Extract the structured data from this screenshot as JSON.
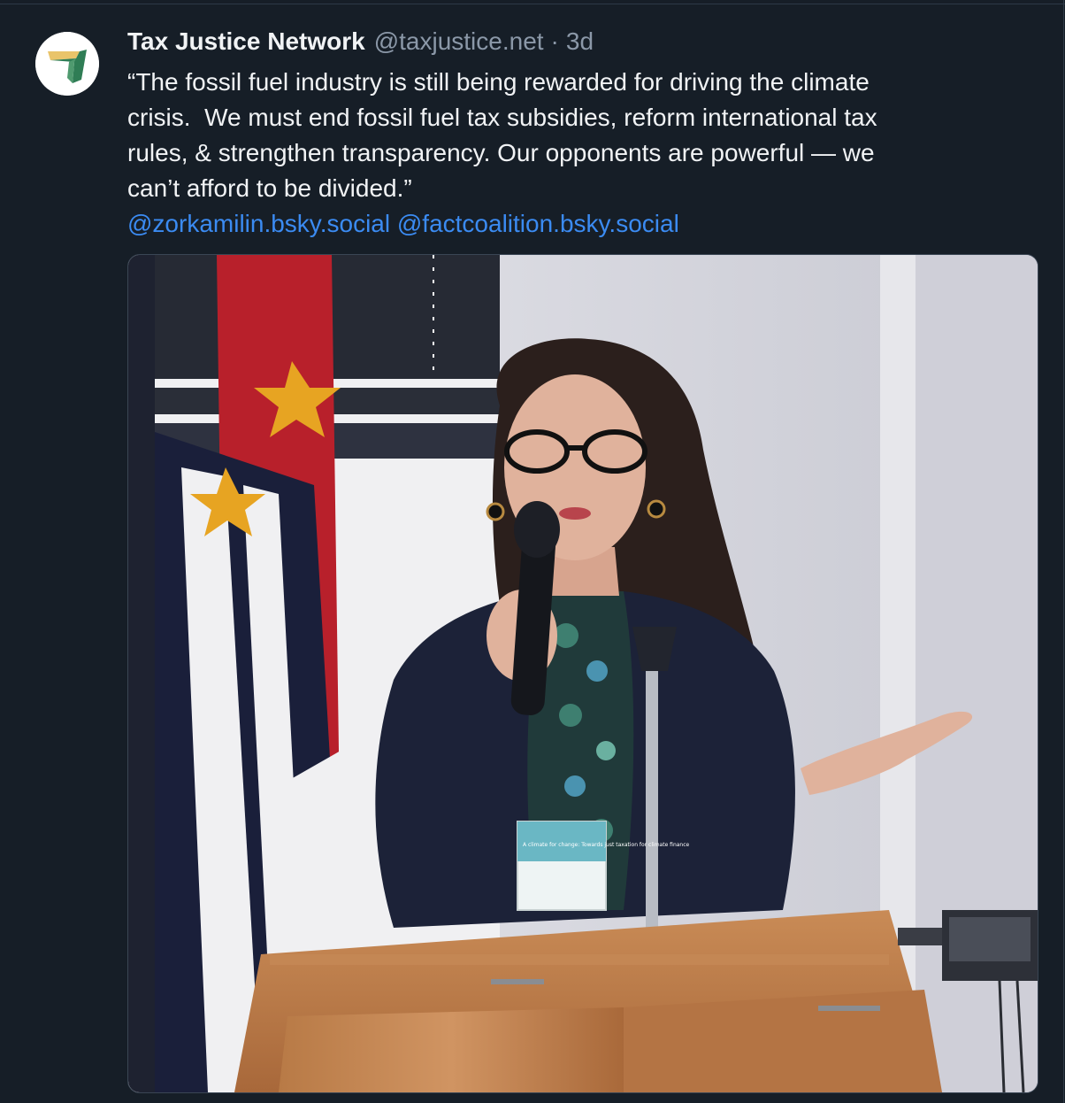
{
  "post": {
    "author": {
      "display_name": "Tax Justice Network",
      "handle": "@taxjustice.net",
      "separator": "·",
      "time_ago": "3d",
      "avatar_icon": "tax-justice-network-logo"
    },
    "text_lines": [
      "“The fossil fuel industry is still being rewarded for driving the climate",
      "crisis.  We must end fossil fuel tax subsidies, reform international tax",
      "rules, & strengthen transparency. Our opponents are powerful — we",
      "can’t afford to be divided.”"
    ],
    "mentions": [
      "@zorkamilin.bsky.social",
      "@factcoalition.bsky.social"
    ],
    "image": {
      "badge_text": "A climate for change: Towards just taxation for climate finance"
    }
  },
  "colors": {
    "background": "#161e27",
    "text": "#f1f3f5",
    "muted": "#8b98a8",
    "link": "#3b8bf2"
  }
}
